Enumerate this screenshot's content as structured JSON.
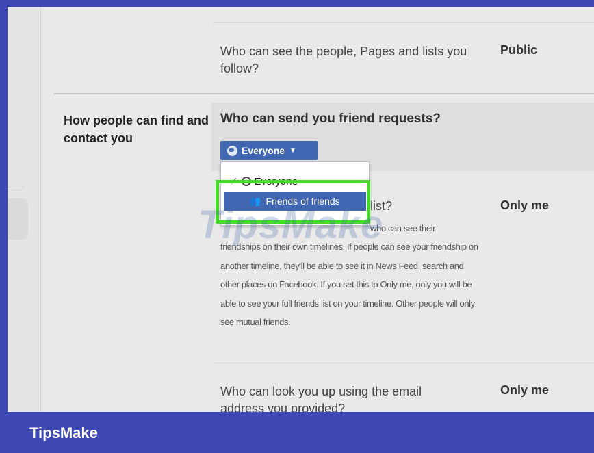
{
  "rows": {
    "follow": {
      "question": "Who can see the people, Pages and lists you follow?",
      "value": "Public"
    },
    "section_label": "How people can find and contact you",
    "friend_requests": {
      "question": "Who can send you friend requests?",
      "button_label": "Everyone",
      "dropdown": {
        "option_everyone": "Everyone",
        "option_friends_of_friends": "Friends of friends"
      }
    },
    "friends_list": {
      "question_tail": "list?",
      "value": "Only me",
      "desc_first_line_tail": "who can see their",
      "description": "friendships on their own timelines. If people can see your friendship on another timeline, they'll be able to see it in News Feed, search and other places on Facebook. If you set this to Only me, only you will be able to see your full friends list on your timeline. Other people will only see mutual friends."
    },
    "email_lookup": {
      "question": "Who can look you up using the email address you provided?",
      "value": "Only me"
    }
  },
  "watermark": "TipsMake",
  "footer": {
    "brand": "TipsMake"
  },
  "colors": {
    "accent": "#4267b2",
    "highlight": "#46d82a",
    "border_blue": "#3d48b4"
  }
}
